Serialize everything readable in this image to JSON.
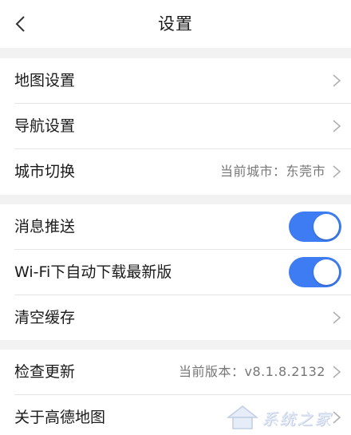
{
  "header": {
    "title": "设置",
    "back_icon": "chevron-left-icon"
  },
  "group1": {
    "items": [
      {
        "label": "地图设置",
        "icon": "chevron-right-icon"
      },
      {
        "label": "导航设置",
        "icon": "chevron-right-icon"
      },
      {
        "label": "城市切换",
        "value": "当前城市：东莞市",
        "icon": "chevron-right-icon"
      }
    ]
  },
  "group2": {
    "items": [
      {
        "label": "消息推送",
        "toggle_on": true
      },
      {
        "label": "Wi-Fi下自动下载最新版",
        "toggle_on": true
      },
      {
        "label": "清空缓存",
        "icon": "chevron-right-icon"
      }
    ]
  },
  "group3": {
    "items": [
      {
        "label": "检查更新",
        "value": "当前版本：v8.1.8.2132",
        "icon": "chevron-right-icon"
      },
      {
        "label": "关于高德地图",
        "icon": "chevron-right-icon"
      }
    ]
  },
  "watermark": {
    "text": "系统之家"
  },
  "colors": {
    "toggle_on": "#3d7cf2",
    "background": "#f2f2f2",
    "row_background": "#ffffff",
    "secondary_text": "#777777"
  }
}
